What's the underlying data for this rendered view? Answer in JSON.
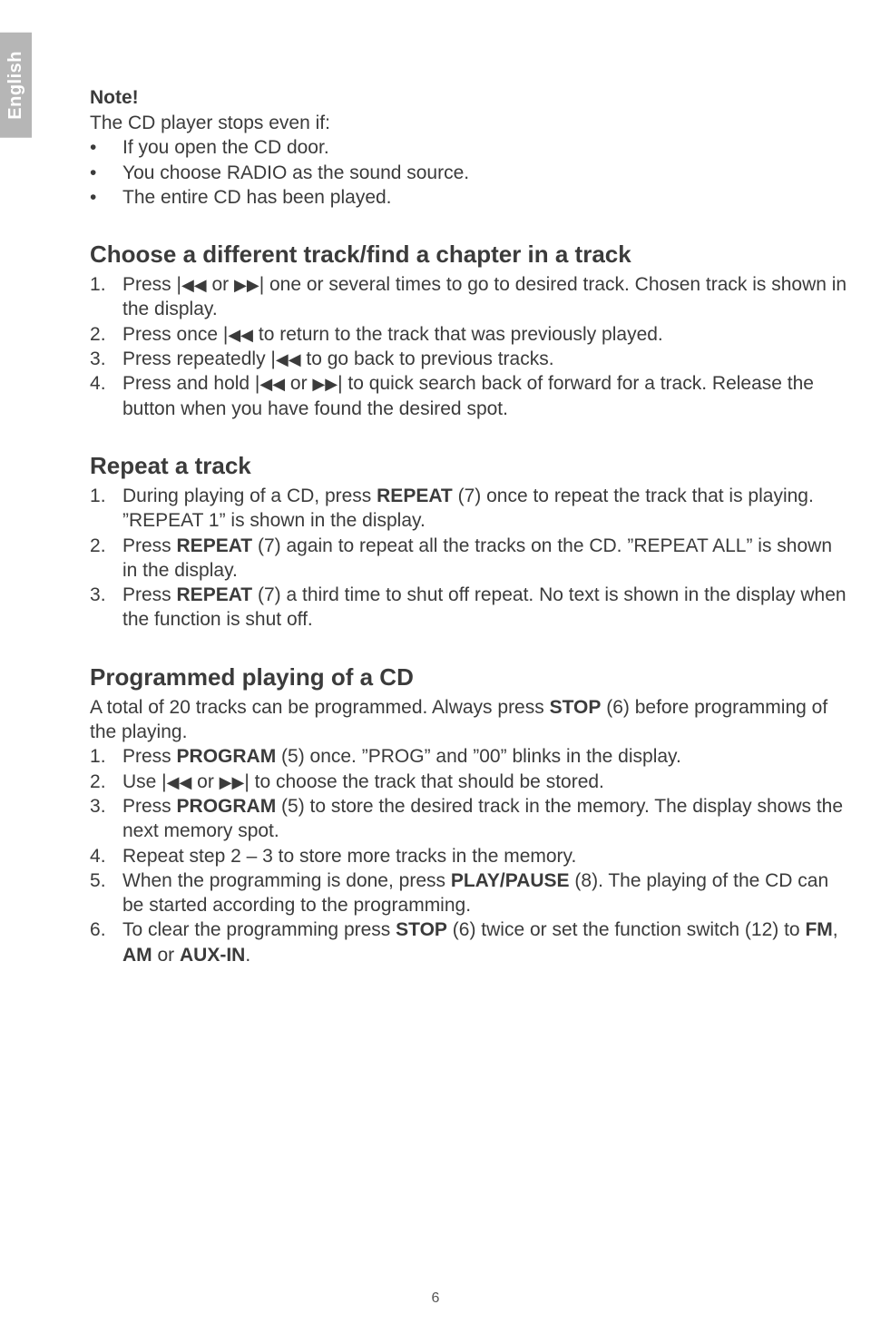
{
  "lang_tab": "English",
  "note": {
    "label": "Note!",
    "intro": "The CD player stops even if:",
    "bullets": [
      "If you open the CD door.",
      "You choose RADIO as the sound source.",
      "The entire CD has been played."
    ]
  },
  "section1": {
    "heading": "Choose a different track/find a chapter in a track",
    "items": {
      "i1_a": "Press |",
      "i1_b": " or ",
      "i1_c": "| one or several times to go to desired track. Chosen track is shown in the display.",
      "i2_a": "Press once |",
      "i2_b": " to return to the track that was previously played.",
      "i3_a": "Press repeatedly |",
      "i3_b": " to go back to previous tracks.",
      "i4_a": "Press and hold |",
      "i4_b": " or ",
      "i4_c": "| to quick search back of forward for a track. Release the button when you have found the desired spot."
    }
  },
  "section2": {
    "heading": "Repeat a track",
    "items": {
      "i1_a": "During playing of a CD, press ",
      "i1_bold": "REPEAT",
      "i1_b": " (7) once to repeat the track that is playing. ”REPEAT 1” is shown in the display.",
      "i2_a": "Press ",
      "i2_bold": "REPEAT",
      "i2_b": " (7) again to repeat all the tracks on the CD. ”REPEAT ALL” is shown in the display.",
      "i3_a": "Press ",
      "i3_bold": "REPEAT",
      "i3_b": " (7) a third time to shut off repeat. No text is shown in the display when the function is shut off."
    }
  },
  "section3": {
    "heading": "Programmed playing of a CD",
    "intro_a": "A total of 20 tracks can be programmed. Always press ",
    "intro_bold": "STOP",
    "intro_b": " (6) before programming of the playing.",
    "items": {
      "i1_a": "Press ",
      "i1_bold": "PROGRAM",
      "i1_b": " (5) once. ”PROG” and ”00” blinks in the display.",
      "i2_a": "Use |",
      "i2_b": " or ",
      "i2_c": "| to choose the track that should be stored.",
      "i3_a": "Press ",
      "i3_bold": "PROGRAM",
      "i3_b": " (5) to store the desired track in the memory. The display shows the next memory spot.",
      "i4": "Repeat step 2 – 3 to store more tracks in the memory.",
      "i5_a": "When the programming is done, press ",
      "i5_bold": "PLAY/PAUSE",
      "i5_b": " (8). The playing of the CD can be started according to the programming.",
      "i6_a": "To clear the programming press ",
      "i6_bold1": "STOP",
      "i6_b": " (6) twice or set the function switch (12) to ",
      "i6_bold2": "FM",
      "i6_c": ", ",
      "i6_bold3": "AM",
      "i6_d": " or ",
      "i6_bold4": "AUX-IN",
      "i6_e": "."
    }
  },
  "page_number": "6",
  "glyphs": {
    "prev": "◀◀",
    "next": "▶▶"
  }
}
